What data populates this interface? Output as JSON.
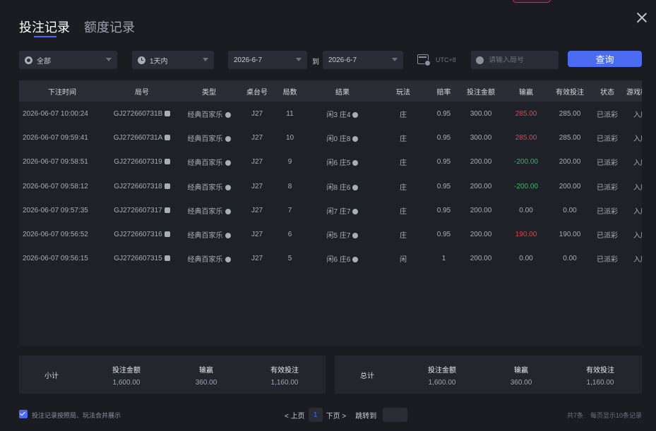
{
  "tabs": [
    "投注记录",
    "额度记录"
  ],
  "filters": {
    "type": "全部",
    "range": "1天内",
    "date_from": "2026-6-7",
    "to": "到",
    "date_to": "2026-6-7",
    "timezone": "UTC+8",
    "search_placeholder": "请输入局号",
    "query": "查询"
  },
  "columns": [
    "下注时间",
    "局号",
    "类型",
    "桌台号",
    "局数",
    "结果",
    "玩法",
    "赔率",
    "投注金额",
    "输赢",
    "有效投注",
    "状态",
    "游戏模式"
  ],
  "rows": [
    {
      "time": "2026-06-07 10:00:24",
      "id": "GJ272660731B",
      "type": "经典百家乐",
      "table": "J27",
      "round": "11",
      "result": "闲3 庄4",
      "bet": "庄",
      "odds": "0.95",
      "amount": "300.00",
      "win": "285.00",
      "win_tone": "red",
      "valid": "285.00",
      "status": "已派彩",
      "mode": "入座"
    },
    {
      "time": "2026-06-07 09:59:41",
      "id": "GJ272660731A",
      "type": "经典百家乐",
      "table": "J27",
      "round": "10",
      "result": "闲0 庄8",
      "bet": "庄",
      "odds": "0.95",
      "amount": "300.00",
      "win": "285.00",
      "win_tone": "red",
      "valid": "285.00",
      "status": "已派彩",
      "mode": "入座"
    },
    {
      "time": "2026-06-07 09:58:51",
      "id": "GJ2726607319",
      "type": "经典百家乐",
      "table": "J27",
      "round": "9",
      "result": "闲6 庄5",
      "bet": "庄",
      "odds": "0.95",
      "amount": "200.00",
      "win": "-200.00",
      "win_tone": "green",
      "valid": "200.00",
      "status": "已派彩",
      "mode": "入座"
    },
    {
      "time": "2026-06-07 09:58:12",
      "id": "GJ2726607318",
      "type": "经典百家乐",
      "table": "J27",
      "round": "8",
      "result": "闲8 庄6",
      "bet": "庄",
      "odds": "0.95",
      "amount": "200.00",
      "win": "-200.00",
      "win_tone": "green",
      "valid": "200.00",
      "status": "已派彩",
      "mode": "入座"
    },
    {
      "time": "2026-06-07 09:57:35",
      "id": "GJ2726607317",
      "type": "经典百家乐",
      "table": "J27",
      "round": "7",
      "result": "闲7 庄7",
      "bet": "庄",
      "odds": "0.95",
      "amount": "200.00",
      "win": "0.00",
      "win_tone": "normal",
      "valid": "0.00",
      "status": "已派彩",
      "mode": "入座"
    },
    {
      "time": "2026-06-07 09:56:52",
      "id": "GJ2726607316",
      "type": "经典百家乐",
      "table": "J27",
      "round": "6",
      "result": "闲5 庄7",
      "bet": "庄",
      "odds": "0.95",
      "amount": "200.00",
      "win": "190.00",
      "win_tone": "red",
      "valid": "190.00",
      "status": "已派彩",
      "mode": "入座"
    },
    {
      "time": "2026-06-07 09:56:15",
      "id": "GJ2726607315",
      "type": "经典百家乐",
      "table": "J27",
      "round": "5",
      "result": "闲6 庄6",
      "bet": "闲",
      "odds": "1",
      "amount": "200.00",
      "win": "0.00",
      "win_tone": "normal",
      "valid": "0.00",
      "status": "已派彩",
      "mode": "入座"
    }
  ],
  "subtotal": {
    "label": "小计",
    "amount_label": "投注金额",
    "amount": "1,600.00",
    "win_label": "输赢",
    "win": "360.00",
    "valid_label": "有效投注",
    "valid": "1,160.00"
  },
  "total": {
    "label": "总计",
    "amount_label": "投注金额",
    "amount": "1,600.00",
    "win_label": "输赢",
    "win": "360.00",
    "valid_label": "有效投注",
    "valid": "1,160.00"
  },
  "footer": {
    "merge_label": "投注记录按照局、玩法合并展示",
    "merge_checked": true,
    "prev": "< 上页",
    "page": "1",
    "next": "下页 >",
    "jump": "跳转到",
    "count": "共7条",
    "per_page": "每页显示10条记录"
  },
  "colors": {
    "accent": "#4b6cf0",
    "loss": "#22c35d",
    "win": "#e04646"
  }
}
